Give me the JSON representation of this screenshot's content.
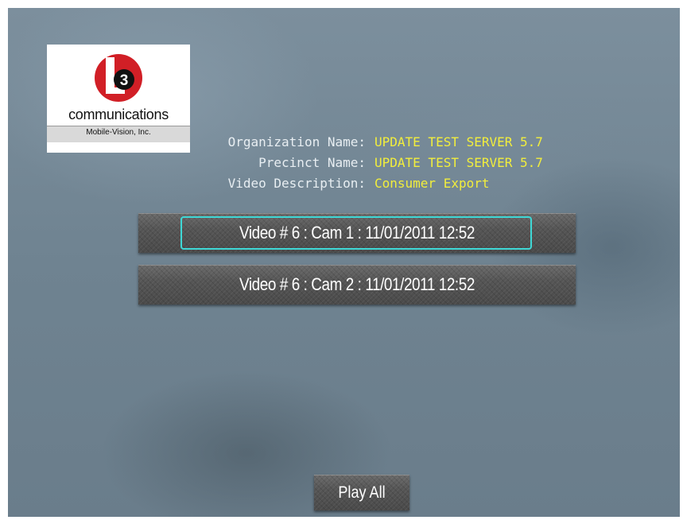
{
  "logo": {
    "mark_text": "3",
    "wordmark": "communications",
    "subtitle": "Mobile-Vision, Inc.",
    "mark_color": "#d11f26"
  },
  "info": {
    "rows": [
      {
        "label": "Organization Name:",
        "value": "UPDATE TEST SERVER 5.7"
      },
      {
        "label": "Precinct Name:",
        "value": "UPDATE TEST SERVER 5.7"
      },
      {
        "label": "Video Description:",
        "value": "Consumer Export"
      }
    ],
    "value_color": "#f2ee3c"
  },
  "videos": [
    {
      "label": "Video # 6 : Cam 1 : 11/01/2011 12:52",
      "focused": true
    },
    {
      "label": "Video # 6 : Cam 2 : 11/01/2011 12:52",
      "focused": false
    }
  ],
  "play_all": {
    "label": "Play All"
  },
  "colors": {
    "focus": "#3fd8d6",
    "button": "#555555"
  }
}
